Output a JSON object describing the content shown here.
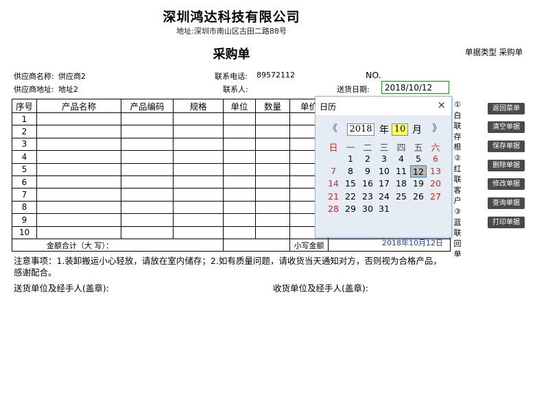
{
  "header": {
    "company": "深圳鸿达科技有限公司",
    "address": "地址:深圳市南山区古田二路88号",
    "title": "采购单",
    "doc_type": "单据类型 采购单"
  },
  "info": {
    "supplier_name_label": "供应商名称:",
    "supplier_name": "供应商2",
    "phone_label": "联系电话:",
    "phone": "89572112",
    "no_label": "NO.",
    "supplier_addr_label": "供应商地址:",
    "supplier_addr": "地址2",
    "contact_label": "联系人:",
    "delivery_label": "送货日期:",
    "delivery_date": "2018/10/12"
  },
  "table": {
    "headers": [
      "序号",
      "产品名称",
      "产品编码",
      "规格",
      "单位",
      "数量",
      "单价"
    ],
    "rows": [
      "1",
      "2",
      "3",
      "4",
      "5",
      "6",
      "7",
      "8",
      "9",
      "10"
    ],
    "sum_label": "金额合计（大 写）：",
    "small_label": "小写金额"
  },
  "notes": {
    "line1": "注意事项：1.装卸搬运小心轻放，请放在室内储存；2.如有质量问题，请收货当天通知对方，否则视为合格产品，",
    "line2": "感谢配合。",
    "sender": "送货单位及经手人(盖章):",
    "receiver": "收货单位及经手人(盖章):"
  },
  "stub": [
    "①",
    "白",
    "联",
    "存",
    "根",
    "②",
    "红",
    "联",
    "客",
    "户",
    "③",
    "蓝",
    "联",
    "回",
    "单"
  ],
  "buttons": [
    "返回菜单",
    "清空单据",
    "保存单据",
    "删除单据",
    "修改单据",
    "查询单据",
    "打印单据"
  ],
  "calendar": {
    "title": "日历",
    "close": "×",
    "prev": "《",
    "next": "》",
    "year": "2018",
    "year_label": "年",
    "month": "10",
    "month_label": "月",
    "weekdays": [
      "日",
      "一",
      "二",
      "三",
      "四",
      "五",
      "六"
    ],
    "days": [
      "1",
      "2",
      "3",
      "4",
      "5",
      "6",
      "7",
      "8",
      "9",
      "10",
      "11",
      "12",
      "13",
      "14",
      "15",
      "16",
      "17",
      "18",
      "19",
      "20",
      "21",
      "22",
      "23",
      "24",
      "25",
      "26",
      "27",
      "28",
      "29",
      "30",
      "31"
    ],
    "first_weekday": 1,
    "selected": 12,
    "today_text": "2018年10月12日",
    "weekend_color": "#e02020"
  }
}
